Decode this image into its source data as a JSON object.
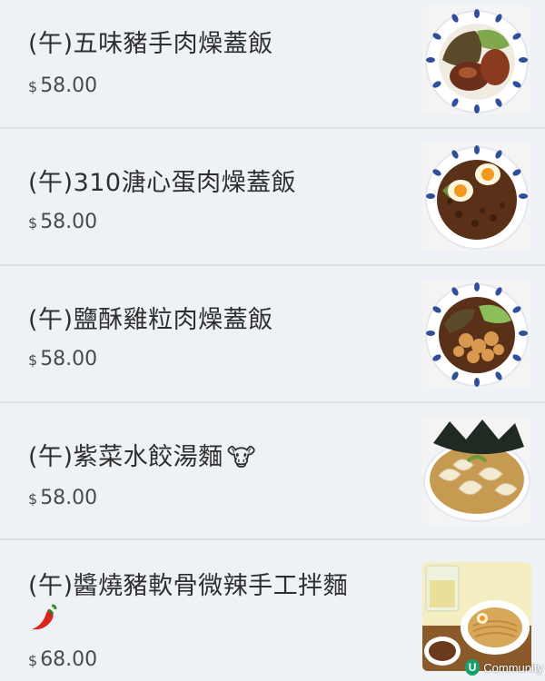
{
  "currency_symbol": "$",
  "items": [
    {
      "name": "(午)五味豬手肉燥蓋飯",
      "price": "58.00",
      "image": "pork-knuckle-minced-pork-rice"
    },
    {
      "name": "(午)310溏心蛋肉燥蓋飯",
      "price": "58.00",
      "image": "soft-egg-minced-pork-rice"
    },
    {
      "name": "(午)鹽酥雞粒肉燥蓋飯",
      "price": "58.00",
      "image": "popcorn-chicken-minced-pork-rice"
    },
    {
      "name": "(午)紫菜水餃湯麵",
      "emoji": "🐮",
      "price": "58.00",
      "image": "seaweed-dumpling-noodle-soup"
    },
    {
      "name": "(午)醬燒豬軟骨微辣手工拌麵",
      "emoji": "🌶️",
      "price": "68.00",
      "image": "pork-cartilage-mixed-noodles"
    }
  ],
  "watermark": {
    "logo": "U",
    "text": "Community"
  }
}
